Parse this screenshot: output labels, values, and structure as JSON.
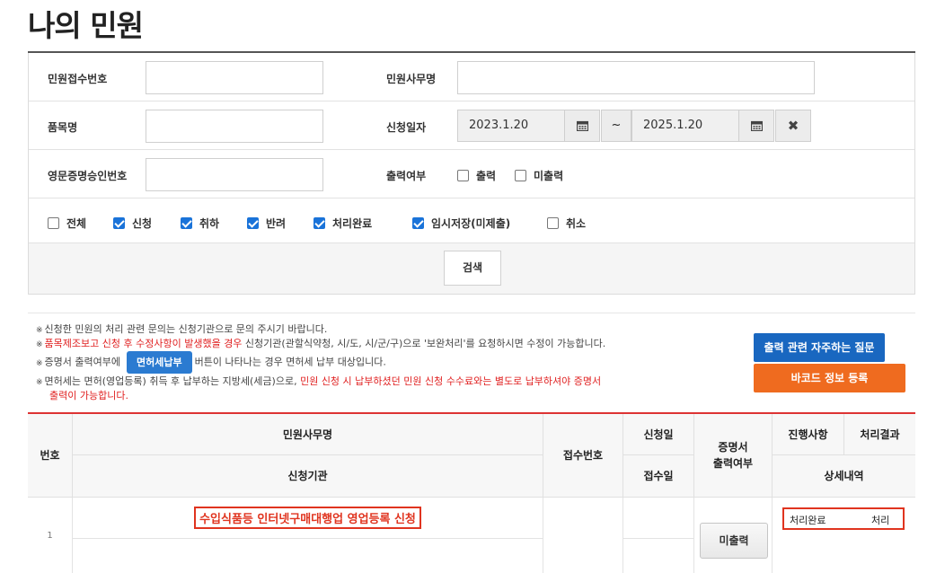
{
  "page": {
    "title": "나의 민원"
  },
  "form": {
    "receipt_no_label": "민원접수번호",
    "office_name_label": "민원사무명",
    "product_name_label": "품목명",
    "apply_date_label": "신청일자",
    "date_from": "2023.1.20",
    "date_to": "2025.1.20",
    "date_separator": "~",
    "clear_symbol": "✖",
    "cert_no_label": "영문증명승인번호",
    "print_status_label": "출력여부",
    "print_options": [
      {
        "label": "출력",
        "checked": false
      },
      {
        "label": "미출력",
        "checked": false
      }
    ],
    "status_filters": [
      {
        "label": "전체",
        "checked": false
      },
      {
        "label": "신청",
        "checked": true
      },
      {
        "label": "취하",
        "checked": true
      },
      {
        "label": "반려",
        "checked": true
      },
      {
        "label": "처리완료",
        "checked": true
      },
      {
        "label": "임시저장(미제출)",
        "checked": true
      },
      {
        "label": "취소",
        "checked": false
      }
    ],
    "search_label": "검색"
  },
  "notices": {
    "n1": "신청한 민원의 처리 관련 문의는 신청기관으로 문의 주시기 바랍니다.",
    "n2_red": "품목제조보고 신청 후 수정사항이 발생했을 경우",
    "n2_rest": " 신청기관(관할식약청, 시/도, 시/군/구)으로 '보완처리'를 요청하시면 수정이 가능합니다.",
    "n3_pre": "증명서 출력여부에",
    "n3_btn": "면허세납부",
    "n3_post": "버튼이 나타나는 경우 면허세 납부 대상입니다.",
    "n4_pre": "면허세는 면허(영업등록) 취득 후 납부하는 지방세(세금)으로, ",
    "n4_red1": "민원 신청 시 납부하셨던 민원 신청 수수료와는 별도로 납부하셔야 증명서",
    "n4_red2": "출력이 가능합니다."
  },
  "side_buttons": {
    "faq": "출력 관련 자주하는 질문",
    "barcode": "바코드 정보 등록"
  },
  "table": {
    "headers": {
      "no": "번호",
      "office_name": "민원사무명",
      "agency": "신청기관",
      "receipt_no": "접수번호",
      "apply_date": "신청일",
      "receipt_date": "접수일",
      "cert_print": "증명서\n출력여부",
      "progress": "진행사항",
      "result": "처리결과",
      "detail": "상세내역"
    },
    "rows": [
      {
        "no": "1",
        "title": "수입식품등 인터넷구매대행업 영업등록 신청",
        "agency": "",
        "receipt_no": "",
        "apply_date": "",
        "receipt_date": "",
        "print_button": "미출력",
        "progress": "처리완료",
        "result": "처리"
      }
    ]
  }
}
